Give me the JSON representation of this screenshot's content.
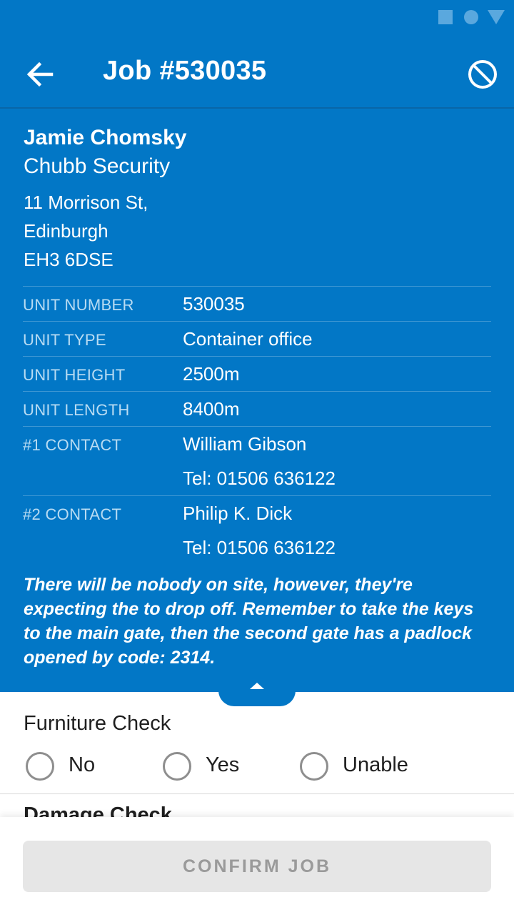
{
  "app_bar": {
    "title": "Job #530035",
    "back_icon": "arrow-left-icon",
    "cancel_icon": "block-icon"
  },
  "customer": {
    "name": "Jamie Chomsky",
    "company": "Chubb Security",
    "address": [
      "11 Morrison St,",
      "Edinburgh",
      "EH3 6DSE"
    ]
  },
  "details": [
    {
      "label": "UNIT NUMBER",
      "values": [
        "530035"
      ]
    },
    {
      "label": "UNIT TYPE",
      "values": [
        "Container office"
      ]
    },
    {
      "label": "UNIT HEIGHT",
      "values": [
        "2500m"
      ]
    },
    {
      "label": "UNIT LENGTH",
      "values": [
        "8400m"
      ]
    },
    {
      "label": "#1 CONTACT",
      "values": [
        "William Gibson",
        "Tel: 01506 636122"
      ]
    },
    {
      "label": "#2 CONTACT",
      "values": [
        "Philip K. Dick",
        "Tel: 01506 636122"
      ]
    }
  ],
  "note": "There will be nobody on site, however, they're expecting the to drop off. Remember to take the keys to the main gate, then the second gate has a padlock opened by code: 2314.",
  "checks": [
    {
      "title": "Furniture Check",
      "options": [
        "No",
        "Yes",
        "Unable"
      ]
    },
    {
      "title": "Damage Check"
    }
  ],
  "confirm_label": "CONFIRM JOB",
  "colors": {
    "primary": "#0277c6",
    "label": "#b9dcf3",
    "button_disabled_bg": "#e6e6e6",
    "button_disabled_text": "#9a9a9a"
  }
}
